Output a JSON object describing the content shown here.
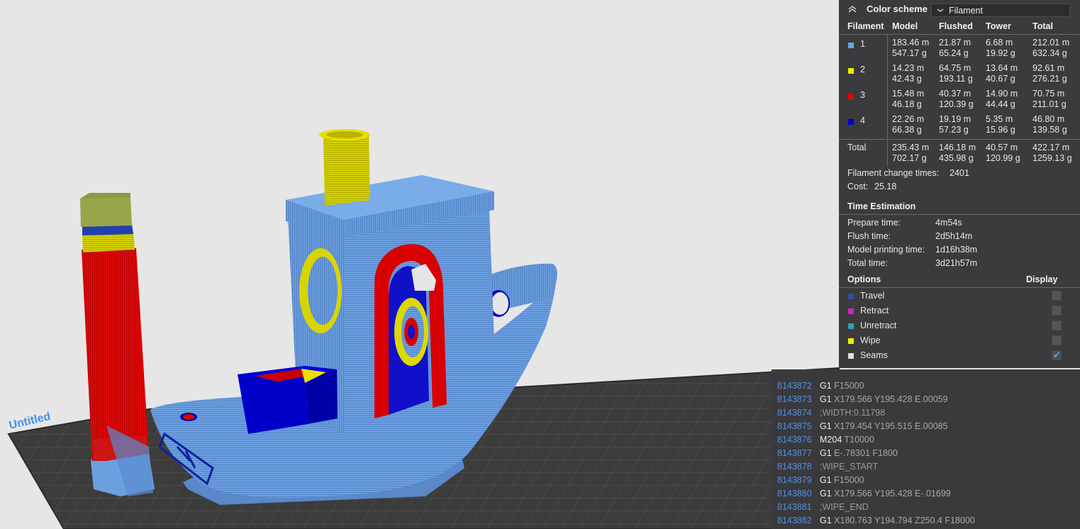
{
  "viewport": {
    "plate_label": "Untitled",
    "colors": {
      "background": "#e6e6e6",
      "plate": "#3a3a3a",
      "filament1": "#6ea4e6",
      "filament2": "#e8e800",
      "filament3": "#dd0000",
      "filament4": "#0000cc"
    }
  },
  "legend": {
    "collapse_icon": "chevron-up-double-icon",
    "title": "Color scheme",
    "scheme": {
      "dropdown_icon": "chevron-down-icon",
      "value": "Filament"
    },
    "columns": [
      "Filament",
      "Model",
      "Flushed",
      "Tower",
      "Total"
    ],
    "filaments": [
      {
        "id": "1",
        "color": "#6ea4e6",
        "model_m": "183.46 m",
        "model_g": "547.17 g",
        "flushed_m": "21.87 m",
        "flushed_g": "65.24 g",
        "tower_m": "6.68 m",
        "tower_g": "19.92 g",
        "total_m": "212.01 m",
        "total_g": "632.34 g"
      },
      {
        "id": "2",
        "color": "#f0f000",
        "model_m": "14.23 m",
        "model_g": "42.43 g",
        "flushed_m": "64.75 m",
        "flushed_g": "193.11 g",
        "tower_m": "13.64 m",
        "tower_g": "40.67 g",
        "total_m": "92.61 m",
        "total_g": "276.21 g"
      },
      {
        "id": "3",
        "color": "#e00000",
        "model_m": "15.48 m",
        "model_g": "46.18 g",
        "flushed_m": "40.37 m",
        "flushed_g": "120.39 g",
        "tower_m": "14.90 m",
        "tower_g": "44.44 g",
        "total_m": "70.75 m",
        "total_g": "211.01 g"
      },
      {
        "id": "4",
        "color": "#0000e0",
        "model_m": "22.26 m",
        "model_g": "66.38 g",
        "flushed_m": "19.19 m",
        "flushed_g": "57.23 g",
        "tower_m": "5.35 m",
        "tower_g": "15.96 g",
        "total_m": "46.80 m",
        "total_g": "139.58 g"
      }
    ],
    "total": {
      "label": "Total",
      "model_m": "235.43 m",
      "model_g": "702.17 g",
      "flushed_m": "146.18 m",
      "flushed_g": "435.98 g",
      "tower_m": "40.57 m",
      "tower_g": "120.99 g",
      "total_m": "422.17 m",
      "total_g": "1259.13 g"
    },
    "change_times": {
      "label": "Filament change times:",
      "value": "2401"
    },
    "cost": {
      "label": "Cost:",
      "value": "25.18"
    },
    "time_estimation": {
      "title": "Time Estimation",
      "rows": [
        {
          "label": "Prepare time:",
          "value": "4m54s"
        },
        {
          "label": "Flush time:",
          "value": "2d5h14m"
        },
        {
          "label": "Model printing time:",
          "value": "1d16h38m"
        },
        {
          "label": "Total time:",
          "value": "3d21h57m"
        }
      ]
    },
    "options": {
      "title": "Options",
      "display_label": "Display",
      "items": [
        {
          "label": "Travel",
          "color": "#3848a8",
          "checked": false
        },
        {
          "label": "Retract",
          "color": "#d020d0",
          "checked": false
        },
        {
          "label": "Unretract",
          "color": "#30a0c0",
          "checked": false
        },
        {
          "label": "Wipe",
          "color": "#f0f000",
          "checked": false
        },
        {
          "label": "Seams",
          "color": "#e0e0e0",
          "checked": true
        }
      ]
    }
  },
  "gcode": {
    "lines": [
      {
        "num": "8143872",
        "cmd": "G1",
        "args": "F15000"
      },
      {
        "num": "8143873",
        "cmd": "G1",
        "args": "X179.566 Y195.428 E.00059"
      },
      {
        "num": "8143874",
        "cmd": "",
        "args": ";WIDTH:0.11798"
      },
      {
        "num": "8143875",
        "cmd": "G1",
        "args": "X179.454 Y195.515 E.00085"
      },
      {
        "num": "8143876",
        "cmd": "M204",
        "args": "T10000"
      },
      {
        "num": "8143877",
        "cmd": "G1",
        "args": "E-.78301 F1800"
      },
      {
        "num": "8143878",
        "cmd": "",
        "args": ";WIPE_START"
      },
      {
        "num": "8143879",
        "cmd": "G1",
        "args": "F15000"
      },
      {
        "num": "8143880",
        "cmd": "G1",
        "args": "X179.566 Y195.428 E-.01699"
      },
      {
        "num": "8143881",
        "cmd": "",
        "args": ";WIPE_END"
      },
      {
        "num": "8143882",
        "cmd": "G1",
        "args": "X180.763 Y194.794 Z250.4 F18000"
      }
    ]
  }
}
